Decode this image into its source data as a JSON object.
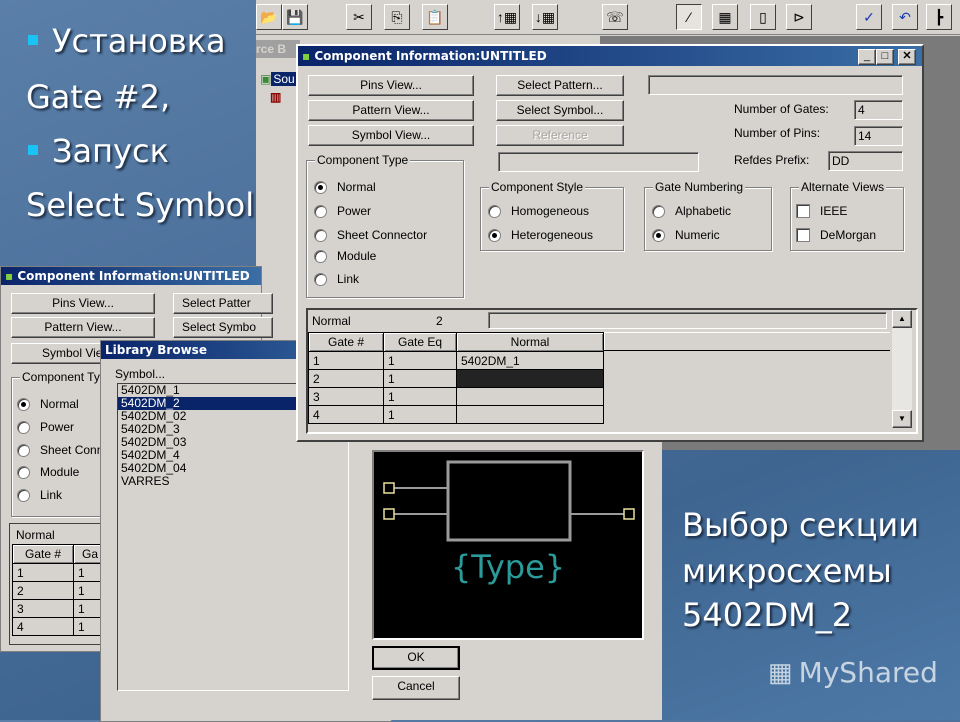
{
  "slide": {
    "bullets": [
      {
        "text": "Установка",
        "continuation": "Gate #2,"
      },
      {
        "text": "Запуск",
        "continuation": "Select Symbol"
      }
    ],
    "caption_lines": [
      "Выбор секции",
      "микросхемы",
      "5402DM_2"
    ],
    "watermark": "MyShared",
    "colors": {
      "bullet": "#19c3f5",
      "background": "#4a6f9a"
    }
  },
  "toolbar": {
    "buttons": [
      {
        "name": "open",
        "glyph": "📂"
      },
      {
        "name": "save",
        "glyph": "💾"
      },
      {
        "name": "cut",
        "glyph": "✂"
      },
      {
        "name": "copy",
        "glyph": "⎘"
      },
      {
        "name": "paste",
        "glyph": "📋"
      },
      {
        "name": "insert-row-above",
        "glyph": "↑▦"
      },
      {
        "name": "insert-row-below",
        "glyph": "↓▦"
      },
      {
        "name": "component-info",
        "glyph": "☏"
      },
      {
        "name": "symbol-pattern",
        "glyph": "⁄"
      },
      {
        "name": "grid-view",
        "glyph": "▦"
      },
      {
        "name": "chip",
        "glyph": "▯"
      },
      {
        "name": "gate",
        "glyph": "⊳"
      },
      {
        "name": "verify",
        "glyph": "✓"
      },
      {
        "name": "undo",
        "glyph": "↶"
      },
      {
        "name": "tree",
        "glyph": "┣"
      }
    ]
  },
  "source_browser": {
    "title_fragment": "rce B",
    "item_fragment": "Sou"
  },
  "main_dialog": {
    "title": "Component Information:UNTITLED",
    "controls": {
      "minimize": "_",
      "maximize": "□",
      "close": "✕"
    },
    "buttons": {
      "pins_view": "Pins View...",
      "pattern_view": "Pattern View...",
      "symbol_view": "Symbol View...",
      "select_pattern": "Select Pattern...",
      "select_symbol": "Select Symbol...",
      "reference": "Reference"
    },
    "pattern_field": "",
    "symbol_field": "",
    "number_of_gates_label": "Number of Gates:",
    "number_of_gates": "4",
    "number_of_pins_label": "Number of Pins:",
    "number_of_pins": "14",
    "refdes_prefix_label": "Refdes Prefix:",
    "refdes_prefix": "DD",
    "component_type": {
      "title": "Component Type",
      "options": [
        "Normal",
        "Power",
        "Sheet Connector",
        "Module",
        "Link"
      ],
      "selected": "Normal"
    },
    "component_style": {
      "title": "Component Style",
      "options": [
        "Homogeneous",
        "Heterogeneous"
      ],
      "selected": "Heterogeneous"
    },
    "gate_numbering": {
      "title": "Gate Numbering",
      "options": [
        "Alphabetic",
        "Numeric"
      ],
      "selected": "Numeric"
    },
    "alternate_views": {
      "title": "Alternate Views",
      "options": [
        {
          "label": "IEEE",
          "checked": false
        },
        {
          "label": "DeMorgan",
          "checked": false
        }
      ]
    },
    "grid": {
      "status_label": "Normal",
      "status_value": "2",
      "edit_value": "",
      "columns": [
        "Gate #",
        "Gate Eq",
        "Normal"
      ],
      "rows": [
        [
          "1",
          "1",
          "5402DM_1"
        ],
        [
          "2",
          "1",
          ""
        ],
        [
          "3",
          "1",
          ""
        ],
        [
          "4",
          "1",
          ""
        ]
      ],
      "selected_row": 2
    }
  },
  "back_dialog": {
    "title": "Component Information:UNTITLED",
    "buttons": {
      "pins_view": "Pins View...",
      "pattern_view": "Pattern View...",
      "symbol_view": "Symbol Vie",
      "select_pattern": "Select Patter",
      "select_symbol": "Select Symbo"
    },
    "component_type_title": "Component Ty",
    "options": [
      "Normal",
      "Power",
      "Sheet Conn",
      "Module",
      "Link"
    ],
    "grid": {
      "status_label": "Normal",
      "columns": [
        "Gate #",
        "Ga"
      ],
      "rows": [
        [
          "1",
          "1"
        ],
        [
          "2",
          "1"
        ],
        [
          "3",
          "1"
        ],
        [
          "4",
          "1"
        ]
      ]
    }
  },
  "library_browse": {
    "title": "Library Browse",
    "symbol_label": "Symbol...",
    "symbols": [
      "5402DM_1",
      "5402DM_2",
      "5402DM_02",
      "5402DM_3",
      "5402DM_03",
      "5402DM_4",
      "5402DM_04",
      "VARRES"
    ],
    "selected": "5402DM_2",
    "preview_text": "{Type}",
    "ok": "OK",
    "cancel": "Cancel"
  }
}
